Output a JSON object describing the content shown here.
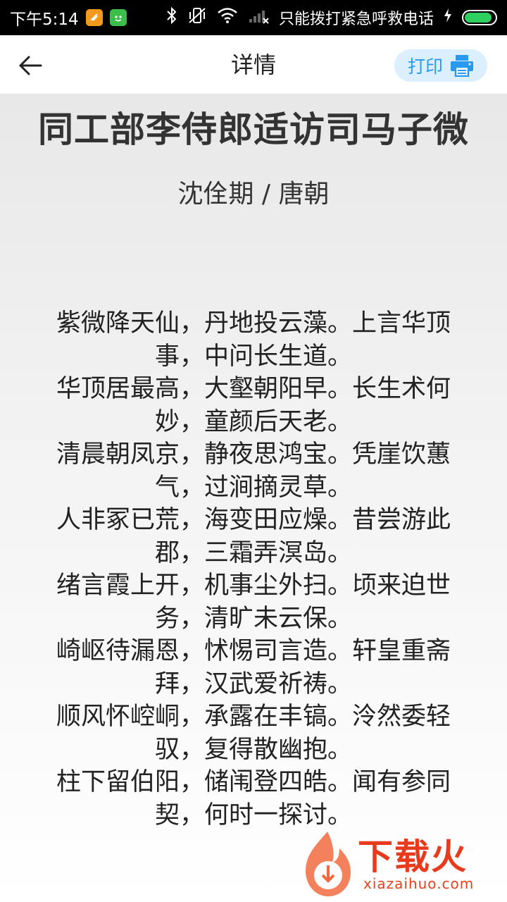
{
  "status_bar": {
    "time": "下午5:14",
    "carrier_text": "只能拨打紧急呼救电话",
    "battery_level": 0.9,
    "icons": [
      "app-orange-icon",
      "app-green-icon",
      "bluetooth-icon",
      "vibrate-off-icon",
      "wifi-icon",
      "signal-none-icon",
      "charging-icon",
      "battery-icon"
    ]
  },
  "app_bar": {
    "title": "详情",
    "print_label": "打印"
  },
  "poem": {
    "title": "同工部李侍郎适访司马子微",
    "author_line": "沈佺期 / 唐朝",
    "lines": [
      "紫微降天仙，丹地投云藻。上言华顶事，中问长生道。",
      "华顶居最高，大壑朝阳早。长生术何妙，童颜后天老。",
      "清晨朝凤京，静夜思鸿宝。凭崖饮蕙气，过涧摘灵草。",
      "人非冢已荒，海变田应燥。昔尝游此郡，三霜弄溟岛。",
      "绪言霞上开，机事尘外扫。顷来迫世务，清旷未云保。",
      "崎岖待漏恩，怵惕司言造。轩皇重斋拜，汉武爱祈祷。",
      "顺风怀崆峒，承露在丰镐。泠然委轻驭，复得散幽抱。",
      "柱下留伯阳，储闱登四皓。闻有参同契，何时一探讨。"
    ]
  },
  "watermark": {
    "brand": "下载火",
    "url": "xiazaihuo.com"
  },
  "colors": {
    "accent": "#2a9af0",
    "print_bg": "#dcefff",
    "battery": "#2ed15f",
    "watermark": "#e83a1c"
  }
}
